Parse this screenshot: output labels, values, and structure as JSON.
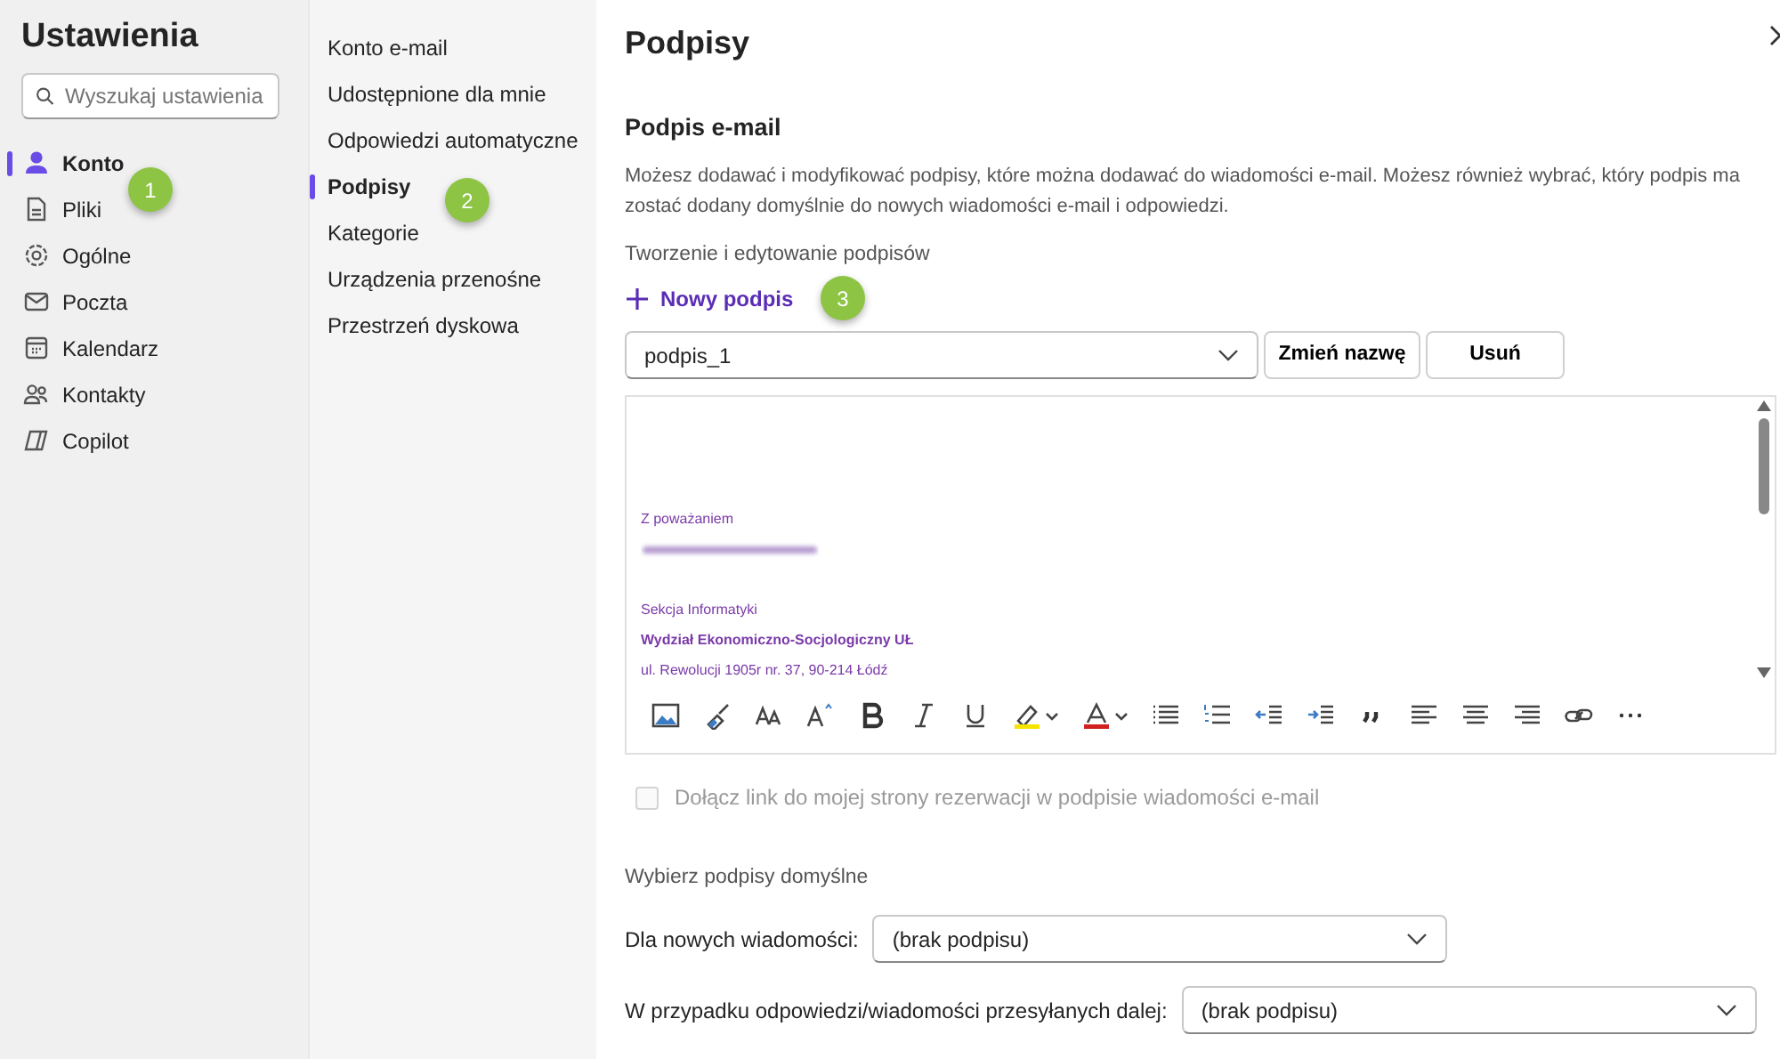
{
  "sidebar": {
    "title": "Ustawienia",
    "search": {
      "placeholder": "Wyszukaj ustawienia"
    },
    "items": [
      {
        "label": "Konto",
        "selected": true
      },
      {
        "label": "Pliki",
        "selected": false
      },
      {
        "label": "Ogólne",
        "selected": false
      },
      {
        "label": "Poczta",
        "selected": false
      },
      {
        "label": "Kalendarz",
        "selected": false
      },
      {
        "label": "Kontakty",
        "selected": false
      },
      {
        "label": "Copilot",
        "selected": false
      }
    ]
  },
  "subnav": {
    "items": [
      {
        "label": "Konto e-mail",
        "selected": false
      },
      {
        "label": "Udostępnione dla mnie",
        "selected": false
      },
      {
        "label": "Odpowiedzi automatyczne",
        "selected": false
      },
      {
        "label": "Podpisy",
        "selected": true
      },
      {
        "label": "Kategorie",
        "selected": false
      },
      {
        "label": "Urządzenia przenośne",
        "selected": false
      },
      {
        "label": "Przestrzeń dyskowa",
        "selected": false
      }
    ]
  },
  "panel": {
    "title": "Podpisy",
    "section_title": "Podpis e-mail",
    "description": "Możesz dodawać i modyfikować podpisy, które można dodawać do wiadomości e-mail. Możesz również wybrać, który podpis ma zostać dodany domyślnie do nowych wiadomości e-mail i odpowiedzi.",
    "create_label": "Tworzenie i edytowanie podpisów",
    "new_button": "Nowy podpis",
    "signature_select": {
      "value": "podpis_1"
    },
    "rename_button": "Zmień nazwę",
    "delete_button": "Usuń",
    "editor_lines": [
      {
        "kind": "text",
        "text": "Z poważaniem",
        "bold": false
      },
      {
        "kind": "blurred"
      },
      {
        "kind": "blank"
      },
      {
        "kind": "text",
        "text": "Sekcja Informatyki",
        "bold": false
      },
      {
        "kind": "text",
        "text": "Wydział Ekonomiczno-Socjologiczny UŁ",
        "bold": true
      },
      {
        "kind": "text",
        "text": "ul. Rewolucji 1905r nr. 37, 90-214 Łódź",
        "bold": false
      }
    ],
    "booking_checkbox": {
      "label": "Dołącz link do mojej strony rezerwacji w podpisie wiadomości e-mail",
      "checked": false,
      "disabled": true
    },
    "defaults_title": "Wybierz podpisy domyślne",
    "defaults": [
      {
        "label": "Dla nowych wiadomości:",
        "value": "(brak podpisu)"
      },
      {
        "label": "W przypadku odpowiedzi/wiadomości przesyłanych dalej:",
        "value": "(brak podpisu)"
      }
    ]
  },
  "callouts": [
    "1",
    "2",
    "3"
  ]
}
